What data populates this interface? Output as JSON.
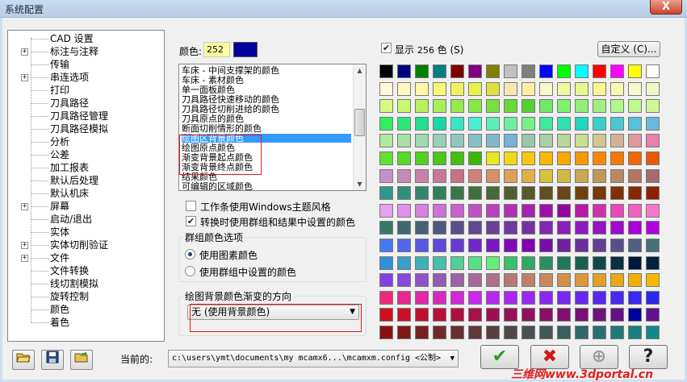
{
  "window": {
    "title": "系统配置",
    "close_label": "X"
  },
  "tree": {
    "items": [
      {
        "label": "CAD 设置",
        "expandable": false
      },
      {
        "label": "标注与注释",
        "expandable": true
      },
      {
        "label": "传输",
        "expandable": false
      },
      {
        "label": "串连选项",
        "expandable": true
      },
      {
        "label": "打印",
        "expandable": false
      },
      {
        "label": "刀具路径",
        "expandable": false
      },
      {
        "label": "刀具路径管理",
        "expandable": false
      },
      {
        "label": "刀具路径模拟",
        "expandable": false
      },
      {
        "label": "分析",
        "expandable": false
      },
      {
        "label": "公差",
        "expandable": false
      },
      {
        "label": "加工报表",
        "expandable": false
      },
      {
        "label": "默认后处理",
        "expandable": false
      },
      {
        "label": "默认机床",
        "expandable": false
      },
      {
        "label": "屏幕",
        "expandable": true
      },
      {
        "label": "启动/退出",
        "expandable": false
      },
      {
        "label": "实体",
        "expandable": false
      },
      {
        "label": "实体切削验证",
        "expandable": true
      },
      {
        "label": "文件",
        "expandable": true
      },
      {
        "label": "文件转换",
        "expandable": false
      },
      {
        "label": "线切割模拟",
        "expandable": false
      },
      {
        "label": "旋转控制",
        "expandable": false
      },
      {
        "label": "颜色",
        "expandable": false
      },
      {
        "label": "着色",
        "expandable": false
      }
    ]
  },
  "color_field": {
    "label": "颜色:",
    "value": "252",
    "swatch_color": "#00009c"
  },
  "color_list": {
    "items": [
      "车床 - 中间支撑架的颜色",
      "车床 - 素材颜色",
      "单一面板颜色",
      "刀具路径快速移动的颜色",
      "刀具路径切削进给的颜色",
      "刀具原点的颜色",
      "断面切削情形的颜色",
      "绘图区背景颜色",
      "绘图原点颜色",
      "渐变背景起点颜色",
      "渐变背景终点颜色",
      "结果颜色",
      "可编辑的区域颜色"
    ],
    "selected_index": 7
  },
  "options": {
    "windows_theme": {
      "label": "工作条使用Windows主题风格",
      "checked": false
    },
    "convert_group_colors": {
      "label": "转换时使用群组和结果中设置的颜色",
      "checked": true
    }
  },
  "group_color": {
    "title": "群组颜色选项",
    "radio_entity": {
      "label": "使用图素颜色",
      "selected": true
    },
    "radio_group": {
      "label": "使用群组中设置的颜色",
      "selected": false
    }
  },
  "gradient": {
    "title": "绘图背景颜色渐变的方向",
    "selected": "无 (使用背景颜色)"
  },
  "palette": {
    "show_label": "显示",
    "count": "256",
    "unit": "色 (S)",
    "show_checked": true,
    "custom_button": "自定义 (C)...",
    "rows": [
      [
        "#000000",
        "#000080",
        "#008000",
        "#008080",
        "#800000",
        "#800080",
        "#808000",
        "#c0c0c0",
        "#808080",
        "#0000ff",
        "#00ff00",
        "#00ffff",
        "#ff0000",
        "#ff00ff",
        "#ffff00",
        "#ffffff"
      ],
      [
        "#fff8d8",
        "#fff8c0",
        "#fff8a8",
        "#f8f878",
        "#f0f060",
        "#e8f050",
        "#e0e040",
        "#f8e8b0",
        "#fff0a0",
        "#f8f8c8",
        "#f0f8a0",
        "#e8f890",
        "#f8f890",
        "#f8f8b0",
        "#f8f8d0",
        "#f0f8c8"
      ],
      [
        "#d8f880",
        "#c8f870",
        "#b8f060",
        "#a8f058",
        "#98e850",
        "#88e848",
        "#78e040",
        "#68d838",
        "#58d030",
        "#70e868",
        "#80f070",
        "#90f078",
        "#a0f080",
        "#b0f888",
        "#c0f890",
        "#d0f898"
      ],
      [
        "#30f060",
        "#28e878",
        "#20e090",
        "#18d8a8",
        "#38e8c0",
        "#48f0d0",
        "#58f0b8",
        "#68f0a0",
        "#78f088",
        "#40e8a0",
        "#30e0b0",
        "#20d8c0",
        "#38d0c8",
        "#48c8d0",
        "#58c0d8",
        "#68b8e0"
      ],
      [
        "#b0e8a0",
        "#a8e0a8",
        "#a0d8b0",
        "#98d0b8",
        "#90c8c0",
        "#88c0c8",
        "#80b8d0",
        "#78b0d8",
        "#98c8a8",
        "#a8d0a0",
        "#b8d898",
        "#c8e090",
        "#d0c890",
        "#d8b098",
        "#e098a0",
        "#e880a8"
      ],
      [
        "#60e030",
        "#58d828",
        "#50d020",
        "#48c818",
        "#40c010",
        "#38b808",
        "#e8e820",
        "#f0d818",
        "#f8c810",
        "#f8b808",
        "#f8a800",
        "#f89800",
        "#f88800",
        "#f87800",
        "#f06800",
        "#e85800"
      ],
      [
        "#c890c8",
        "#c888b8",
        "#c880a8",
        "#c87898",
        "#c87088",
        "#d08078",
        "#d89068",
        "#e0a058",
        "#e0b048",
        "#d8c040",
        "#d0b848",
        "#c8a850",
        "#c09858",
        "#b88860",
        "#b07868",
        "#a86870"
      ],
      [
        "#309888",
        "#309078",
        "#308868",
        "#308058",
        "#387848",
        "#407040",
        "#486838",
        "#506030",
        "#585828",
        "#605020",
        "#684818",
        "#704010",
        "#783808",
        "#803000",
        "#882800",
        "#902000"
      ],
      [
        "#e8a0f0",
        "#e090e8",
        "#d880e0",
        "#d070d8",
        "#c860d0",
        "#c050c8",
        "#b840c0",
        "#b030b8",
        "#a820b0",
        "#a010a8",
        "#9800a0",
        "#b818a8",
        "#d030b0",
        "#e848b8",
        "#f060c0",
        "#f878c8"
      ],
      [
        "#387868",
        "#406870",
        "#486078",
        "#505880",
        "#585088",
        "#604890",
        "#684098",
        "#7038a0",
        "#7830a8",
        "#8028b0",
        "#8820b8",
        "#9018c0",
        "#9810c8",
        "#a008d0",
        "#a800d8",
        "#b000e0"
      ],
      [
        "#4878f0",
        "#5068e8",
        "#5858e0",
        "#6048d8",
        "#6838d0",
        "#7028c8",
        "#7818c0",
        "#8008b8",
        "#8000b0",
        "#7810a8",
        "#7020a0",
        "#683098",
        "#604090",
        "#585088",
        "#506080",
        "#487078"
      ],
      [
        "#3090d8",
        "#38a0c8",
        "#40b0b8",
        "#48c0a8",
        "#50d098",
        "#58e088",
        "#60f078",
        "#38c070",
        "#30a868",
        "#289060",
        "#207858",
        "#186050",
        "#104848",
        "#083040",
        "#001838",
        "#002040"
      ],
      [
        "#8040e8",
        "#8848d8",
        "#9050c8",
        "#9858b8",
        "#a060a8",
        "#a86898",
        "#b07088",
        "#b87878",
        "#c08068",
        "#c88858",
        "#d09048",
        "#d89838",
        "#e0a028",
        "#e8a818",
        "#f0b008",
        "#f8b800"
      ],
      [
        "#f02878",
        "#e82890",
        "#e028a8",
        "#d828c0",
        "#d028d8",
        "#c828f0",
        "#b828f0",
        "#a828f0",
        "#9828f0",
        "#8828f0",
        "#7828f0",
        "#6828f0",
        "#5828f0",
        "#4828f0",
        "#3828f0",
        "#2828f0"
      ],
      [
        "#d01020",
        "#c81028",
        "#c01030",
        "#b81038",
        "#b01040",
        "#a81048",
        "#a01050",
        "#981058",
        "#901060",
        "#881068",
        "#801070",
        "#781078",
        "#701080",
        "#681088",
        "#00009c",
        "#601090"
      ],
      [
        "#8a1010",
        "#801818",
        "#782020",
        "#702828",
        "#683030",
        "#603838",
        "#584040",
        "#504848",
        "#485050",
        "#405858",
        "#386060",
        "#306868",
        "#287070",
        "#207878",
        "#188080",
        "#108888"
      ]
    ]
  },
  "footer": {
    "current_label": "当前的:",
    "current_path": "c:\\users\\ymt\\documents\\my mcamx6...\\mcamxm.config <公制>",
    "ok_icon": "check-icon",
    "cancel_icon": "x-icon",
    "apply_icon": "plus-circle-icon",
    "help_label": "?",
    "open_icon": "folder-open-icon",
    "save_icon": "floppy-icon",
    "merge_icon": "folder-merge-icon"
  },
  "watermark": "三维网www.3dportal.cn",
  "colors": {
    "selection": "#3399ff",
    "annotation_red": "#e01a1a",
    "ok_green": "#2a9d1f",
    "cancel_red": "#d01818"
  }
}
